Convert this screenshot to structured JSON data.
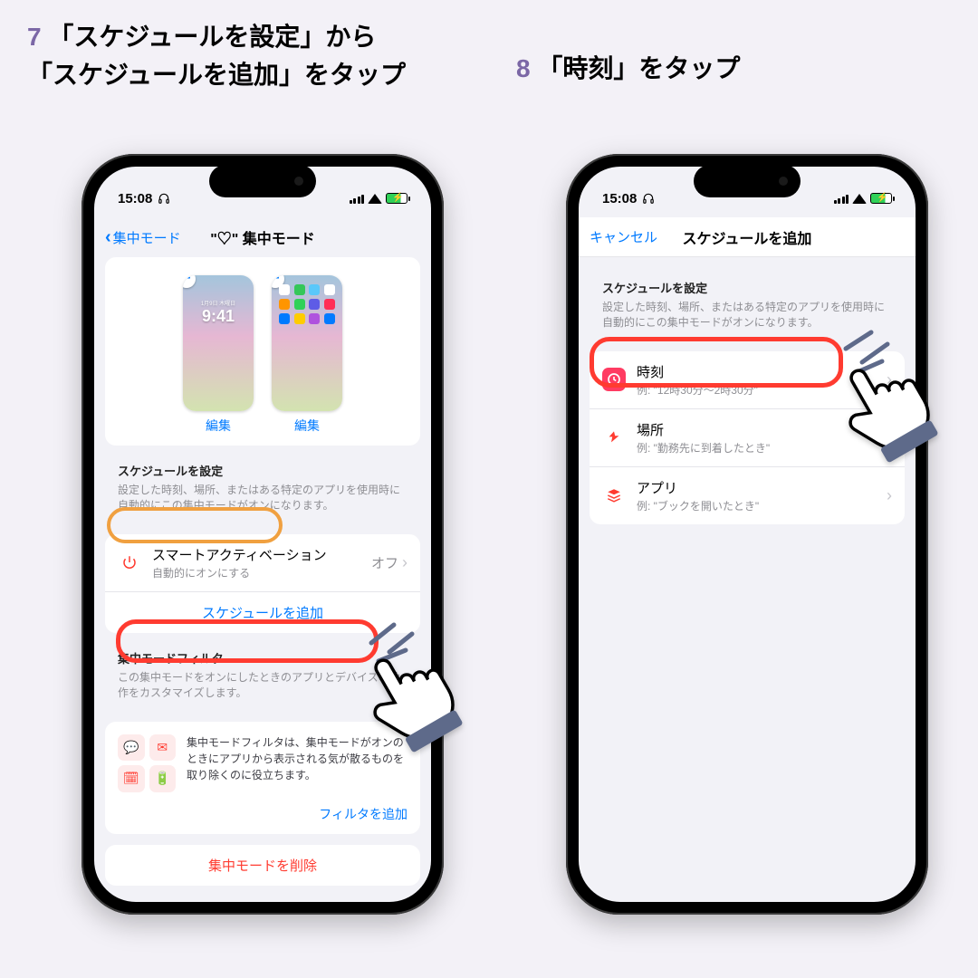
{
  "step7": {
    "number": "7",
    "caption_line1": "「スケジュールを設定」から",
    "caption_line2": "「スケジュールを追加」をタップ"
  },
  "step8": {
    "number": "8",
    "caption": "「時刻」をタップ"
  },
  "status": {
    "time": "15:08"
  },
  "left": {
    "nav_back": "集中モード",
    "nav_title": "\"♡\" 集中モード",
    "preview_clock": "9:41",
    "preview_clock_sub": "1月9日 木曜日",
    "edit_label": "編集",
    "sched_head": "スケジュールを設定",
    "sched_sub": "設定した時刻、場所、またはある特定のアプリを使用時に自動的にこの集中モードがオンになります。",
    "smart_title": "スマートアクティベーション",
    "smart_sub": "自動的にオンにする",
    "smart_trail": "オフ",
    "add_schedule": "スケジュールを追加",
    "filter_head": "集中モードフィルタ",
    "filter_sub": "この集中モードをオンにしたときのアプリとデバイスの動作をカスタマイズします。",
    "filter_desc": "集中モードフィルタは、集中モードがオンのときにアプリから表示される気が散るものを取り除くのに役立ちます。",
    "filter_link": "フィルタを追加",
    "delete": "集中モードを削除"
  },
  "right": {
    "nav_cancel": "キャンセル",
    "nav_title": "スケジュールを追加",
    "head": "スケジュールを設定",
    "sub": "設定した時刻、場所、またはある特定のアプリを使用時に自動的にこの集中モードがオンになります。",
    "time_label": "時刻",
    "time_example": "例: \"12時30分～2時30分\"",
    "place_label": "場所",
    "place_example": "例: \"勤務先に到着したとき\"",
    "app_label": "アプリ",
    "app_example": "例: \"ブックを開いたとき\""
  }
}
